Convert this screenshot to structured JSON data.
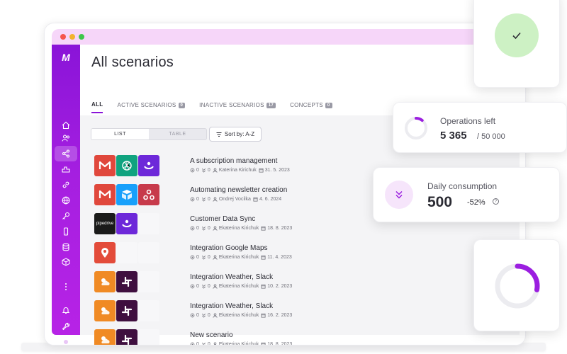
{
  "window": {
    "logo": "M",
    "title": "All scenarios"
  },
  "tabs": [
    {
      "label": "ALL",
      "badge": ""
    },
    {
      "label": "ACTIVE SCENARIOS",
      "badge": "0"
    },
    {
      "label": "INACTIVE SCENARIOS",
      "badge": "17"
    },
    {
      "label": "CONCEPTS",
      "badge": "0"
    }
  ],
  "view_toggle": {
    "list": "LIST",
    "table": "TABLE"
  },
  "sort": {
    "label": "Sort by: A-Z"
  },
  "sidebar": {
    "icons": [
      "home-icon",
      "team-icon",
      "share-icon",
      "templates-icon",
      "link-icon",
      "globe-icon",
      "key-icon",
      "device-icon",
      "database-icon",
      "box-icon",
      "more-icon",
      "bell-icon",
      "wrench-icon",
      "avatar-icon"
    ]
  },
  "scenarios": [
    {
      "title": "A subscription management",
      "ops": "0",
      "errors": "0",
      "author": "Katerina Kirichuk",
      "date": "31. 5. 2023",
      "apps": [
        "gmail",
        "openai",
        "make"
      ]
    },
    {
      "title": "Automating newsletter creation",
      "ops": "0",
      "errors": "0",
      "author": "Ondrej Vocilka",
      "date": "4. 6. 2024",
      "apps": [
        "gmail",
        "airtable",
        "webhooks"
      ]
    },
    {
      "title": "Customer Data Sync",
      "ops": "0",
      "errors": "0",
      "author": "Ekaterina Kirichuk",
      "date": "18. 8. 2023",
      "apps": [
        "pipedrive",
        "make"
      ]
    },
    {
      "title": "Integration Google Maps",
      "ops": "0",
      "errors": "0",
      "author": "Ekaterina Kirichuk",
      "date": "11. 4. 2023",
      "apps": [
        "maps"
      ]
    },
    {
      "title": "Integration Weather, Slack",
      "ops": "0",
      "errors": "0",
      "author": "Ekaterina Kirichuk",
      "date": "10. 2. 2023",
      "apps": [
        "weather",
        "slack"
      ]
    },
    {
      "title": "Integration Weather, Slack",
      "ops": "0",
      "errors": "0",
      "author": "Ekaterina Kirichuk",
      "date": "16. 2. 2023",
      "apps": [
        "weather",
        "slack"
      ]
    },
    {
      "title": "New scenario",
      "ops": "0",
      "errors": "0",
      "author": "Ekaterina Kirichuk",
      "date": "18. 8. 2023",
      "apps": [
        "weather",
        "slack"
      ]
    }
  ],
  "app_labels": {
    "pipedrive": "pipedrive"
  },
  "operations": {
    "label": "Operations left",
    "value": "5 365",
    "total": "/ 50 000",
    "fraction": 0.107
  },
  "daily": {
    "label": "Daily consumption",
    "value": "500",
    "change": "-52%",
    "info": "?"
  },
  "usage_ring": {
    "fraction": 0.28
  },
  "colors": {
    "brand": "#8a14d8",
    "gmail": "#e0473c",
    "openai": "#10a37f",
    "make": "#6d28d9",
    "airtable": "#18a0fb",
    "webhooks": "#c73a4b",
    "pipedrive": "#1a1a1a",
    "maps": "#e34b3a",
    "weather": "#f08a24",
    "slack": "#3f0f3f",
    "success": "#cdf1c4"
  }
}
